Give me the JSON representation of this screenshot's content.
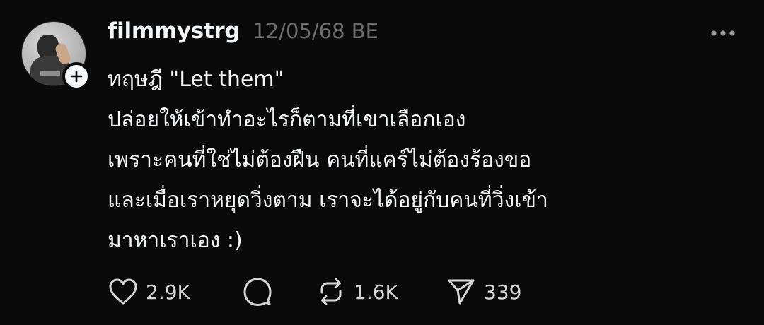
{
  "post": {
    "username": "filmmystrg",
    "timestamp": "12/05/68 BE",
    "lines": [
      "ทฤษฎี \"Let them\"",
      "ปล่อยให้เข้าทำอะไรก็ตามที่เขาเลือกเอง",
      "เพราะคนที่ใช่ไม่ต้องฝืน คนที่แคร์ไม่ต้องร้องขอ",
      "และเมื่อเราหยุดวิ่งตาม เราจะได้อยู่กับคนที่วิ่งเข้า",
      "มาหาเราเอง :)"
    ]
  },
  "actions": {
    "like_count": "2.9K",
    "repost_count": "1.6K",
    "share_count": "339"
  },
  "icons": {
    "follow": "plus-icon",
    "more": "more-horizontal-icon",
    "like": "heart-icon",
    "reply": "comment-icon",
    "repost": "repost-icon",
    "share": "send-icon"
  },
  "colors": {
    "background": "#0a0a0a",
    "text": "#f3f5f7",
    "muted": "#6d6d6d"
  }
}
